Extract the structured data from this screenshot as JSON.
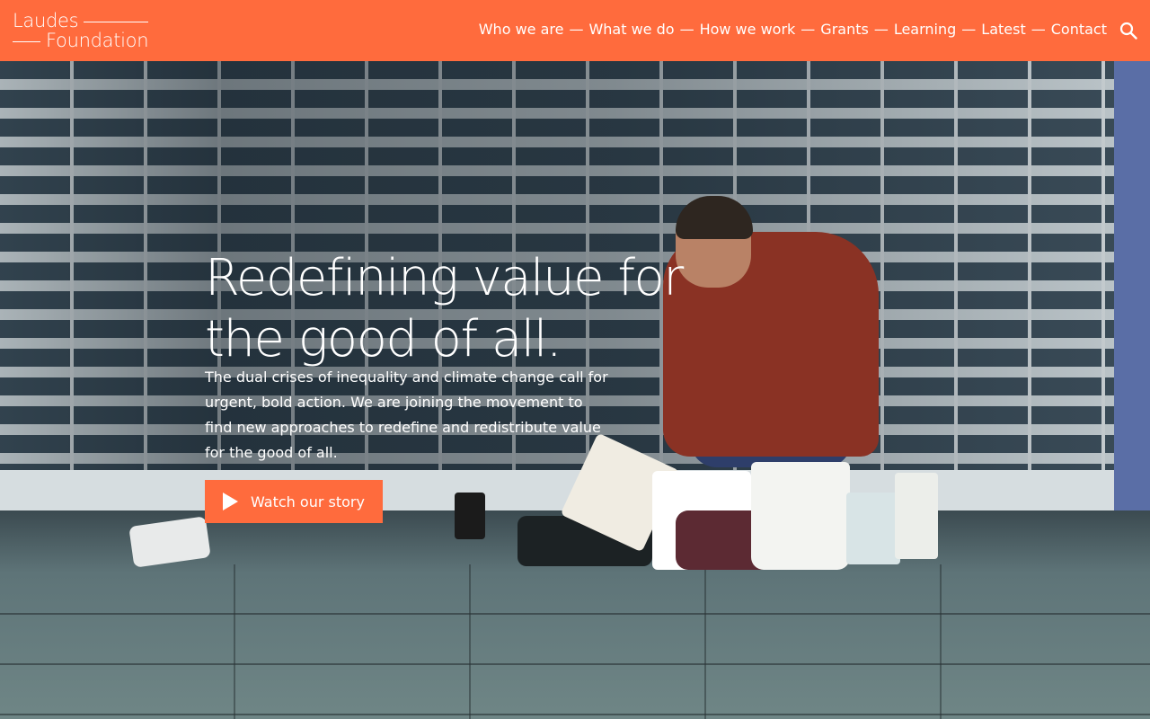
{
  "brand": {
    "line1": "Laudes",
    "line2": "Foundation",
    "accent_color": "#ff6b3d"
  },
  "nav": {
    "separator": "—",
    "items": [
      {
        "label": "Who we are"
      },
      {
        "label": "What we do"
      },
      {
        "label": "How we work"
      },
      {
        "label": "Grants"
      },
      {
        "label": "Learning"
      },
      {
        "label": "Latest"
      },
      {
        "label": "Contact"
      }
    ],
    "search_icon": "search-icon"
  },
  "hero": {
    "title_line1": "Redefining value for",
    "title_line2": "the good of all.",
    "description": "The dual crises of inequality and climate change call for urgent, bold action. We are joining the movement to find new approaches to redefine and redistribute value for the good of all.",
    "cta_label": "Watch our story",
    "cta_icon": "play-icon"
  }
}
